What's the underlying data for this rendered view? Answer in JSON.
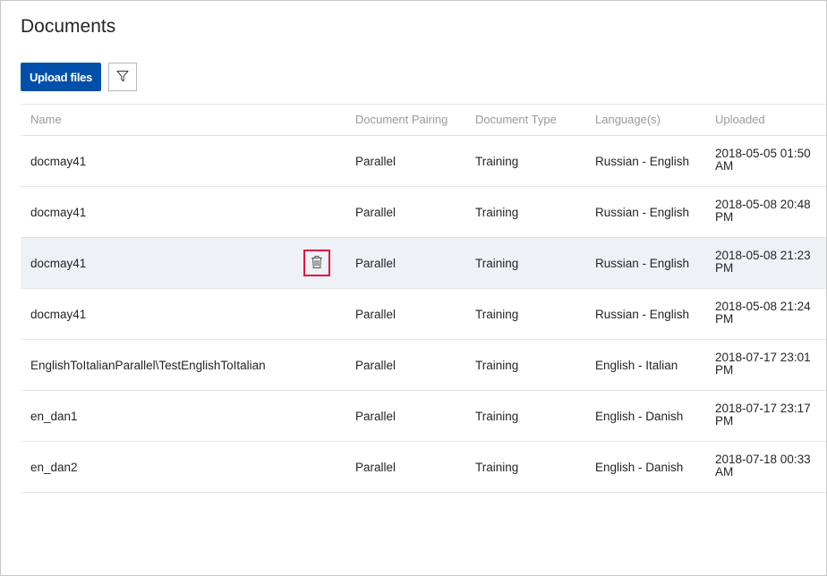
{
  "page": {
    "title": "Documents"
  },
  "toolbar": {
    "upload_label": "Upload files",
    "filter_icon": "filter-icon"
  },
  "table": {
    "columns": [
      "Name",
      "Document Pairing",
      "Document Type",
      "Language(s)",
      "Uploaded"
    ],
    "rows": [
      {
        "name": "docmay41",
        "pairing": "Parallel",
        "type": "Training",
        "language": "Russian - English",
        "uploaded": "2018-05-05 01:50 AM"
      },
      {
        "name": "docmay41",
        "pairing": "Parallel",
        "type": "Training",
        "language": "Russian - English",
        "uploaded": "2018-05-08 20:48 PM"
      },
      {
        "name": "docmay41",
        "pairing": "Parallel",
        "type": "Training",
        "language": "Russian - English",
        "uploaded": "2018-05-08 21:23 PM",
        "hovered": true,
        "delete_icon": "trash-icon"
      },
      {
        "name": "docmay41",
        "pairing": "Parallel",
        "type": "Training",
        "language": "Russian - English",
        "uploaded": "2018-05-08 21:24 PM"
      },
      {
        "name": "EnglishToItalianParallel\\TestEnglishToItalian",
        "pairing": "Parallel",
        "type": "Training",
        "language": "English - Italian",
        "uploaded": "2018-07-17 23:01 PM"
      },
      {
        "name": "en_dan1",
        "pairing": "Parallel",
        "type": "Training",
        "language": "English - Danish",
        "uploaded": "2018-07-17 23:17 PM"
      },
      {
        "name": "en_dan2",
        "pairing": "Parallel",
        "type": "Training",
        "language": "English - Danish",
        "uploaded": "2018-07-18 00:33 AM"
      }
    ]
  },
  "colors": {
    "primary": "#0050aa",
    "highlight": "#e0173a",
    "hover_row": "#eef2f7"
  }
}
